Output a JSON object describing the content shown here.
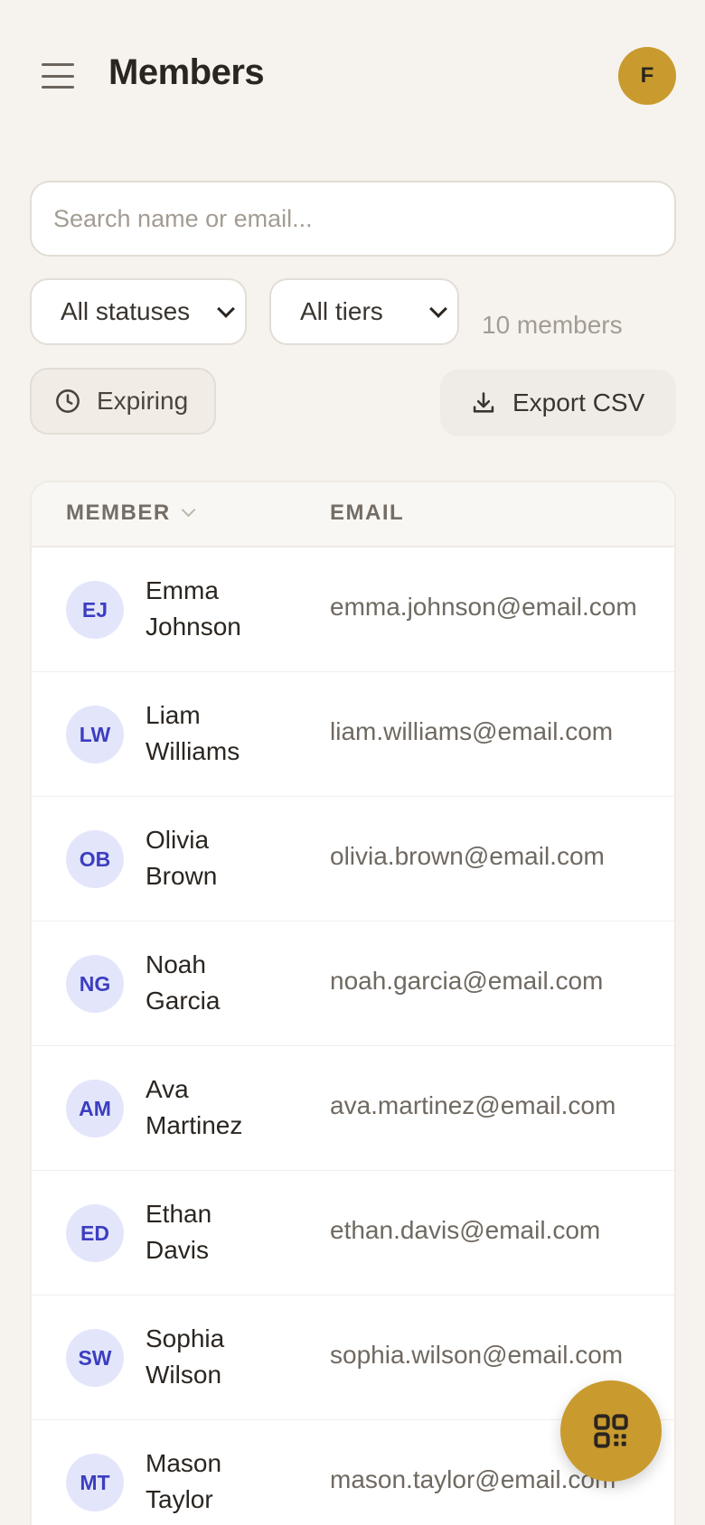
{
  "header": {
    "title": "Members",
    "user_initial": "F"
  },
  "search": {
    "placeholder": "Search name or email..."
  },
  "filters": {
    "status_selected": "All statuses",
    "tier_selected": "All tiers",
    "member_count": "10 members",
    "expiring_label": "Expiring",
    "export_label": "Export CSV"
  },
  "table": {
    "col_member": "MEMBER",
    "col_email": "EMAIL",
    "rows": [
      {
        "initials": "EJ",
        "first": "Emma",
        "last": "Johnson",
        "email": "emma.johnson@email.com"
      },
      {
        "initials": "LW",
        "first": "Liam",
        "last": "Williams",
        "email": "liam.williams@email.com"
      },
      {
        "initials": "OB",
        "first": "Olivia",
        "last": "Brown",
        "email": "olivia.brown@email.com"
      },
      {
        "initials": "NG",
        "first": "Noah",
        "last": "Garcia",
        "email": "noah.garcia@email.com"
      },
      {
        "initials": "AM",
        "first": "Ava",
        "last": "Martinez",
        "email": "ava.martinez@email.com"
      },
      {
        "initials": "ED",
        "first": "Ethan",
        "last": "Davis",
        "email": "ethan.davis@email.com"
      },
      {
        "initials": "SW",
        "first": "Sophia",
        "last": "Wilson",
        "email": "sophia.wilson@email.com"
      },
      {
        "initials": "MT",
        "first": "Mason",
        "last": "Taylor",
        "email": "mason.taylor@email.com"
      }
    ]
  },
  "icons": {
    "menu": "hamburger-menu-icon",
    "expiring": "clock-icon",
    "export": "download-icon",
    "fab": "qr-code-scan-icon"
  },
  "colors": {
    "background": "#f6f3ee",
    "accent": "#c99a2e",
    "avatar_bg": "#e3e6fb",
    "avatar_text": "#3c3ec0"
  }
}
